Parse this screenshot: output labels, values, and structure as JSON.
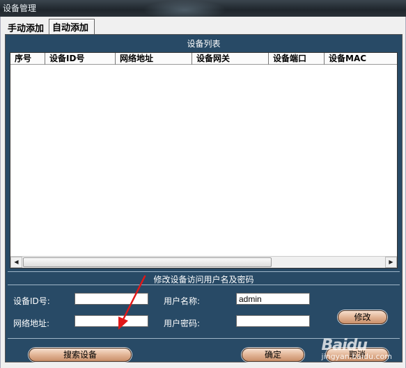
{
  "window": {
    "title": "设备管理"
  },
  "tabs": {
    "manual": "手动添加",
    "auto": "自动添加"
  },
  "device_list": {
    "caption": "设备列表",
    "columns": [
      "序号",
      "设备ID号",
      "网络地址",
      "设备网关",
      "设备端口",
      "设备MAC"
    ],
    "rows": []
  },
  "credentials": {
    "caption": "修改设备访问用户名及密码",
    "device_id_label": "设备ID号:",
    "device_id_value": "",
    "network_address_label": "网络地址:",
    "network_address_value": "",
    "username_label": "用户名称:",
    "username_value": "admin",
    "password_label": "用户密码:",
    "password_value": "",
    "modify_button": "修改"
  },
  "actions": {
    "search_button": "搜索设备",
    "confirm_button": "确定",
    "cancel_button": "取消"
  },
  "watermark": {
    "brand": "Baidu",
    "site": "jingyan.baidu.com"
  },
  "colors": {
    "panel_bg": "#284a66",
    "button_gradient_mid": "#e2b596",
    "annotation_arrow": "#e11818"
  }
}
